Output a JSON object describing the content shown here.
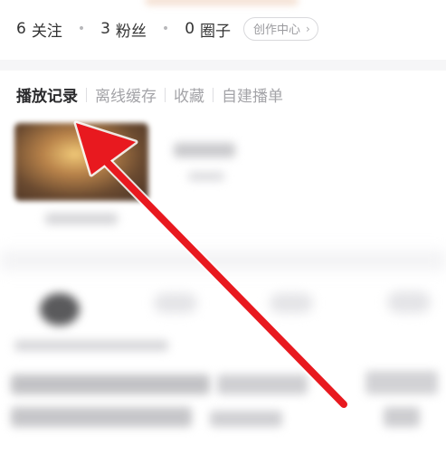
{
  "profile": {
    "stats": [
      {
        "count": "6",
        "label": "关注"
      },
      {
        "count": "3",
        "label": "粉丝"
      },
      {
        "count": "0",
        "label": "圈子"
      }
    ],
    "separator": "•",
    "creator_center_label": "创作中心",
    "chevron": "›"
  },
  "tabs": {
    "items": [
      {
        "label": "播放记录"
      },
      {
        "label": "离线缓存"
      },
      {
        "label": "收藏"
      },
      {
        "label": "自建播单"
      }
    ],
    "active": "播放记录"
  },
  "annotation": {
    "type": "red-arrow-pointer",
    "color": "#e8191f",
    "target": "播放记录"
  },
  "icons": [
    "chevron-right-icon",
    "red-arrow-icon"
  ]
}
